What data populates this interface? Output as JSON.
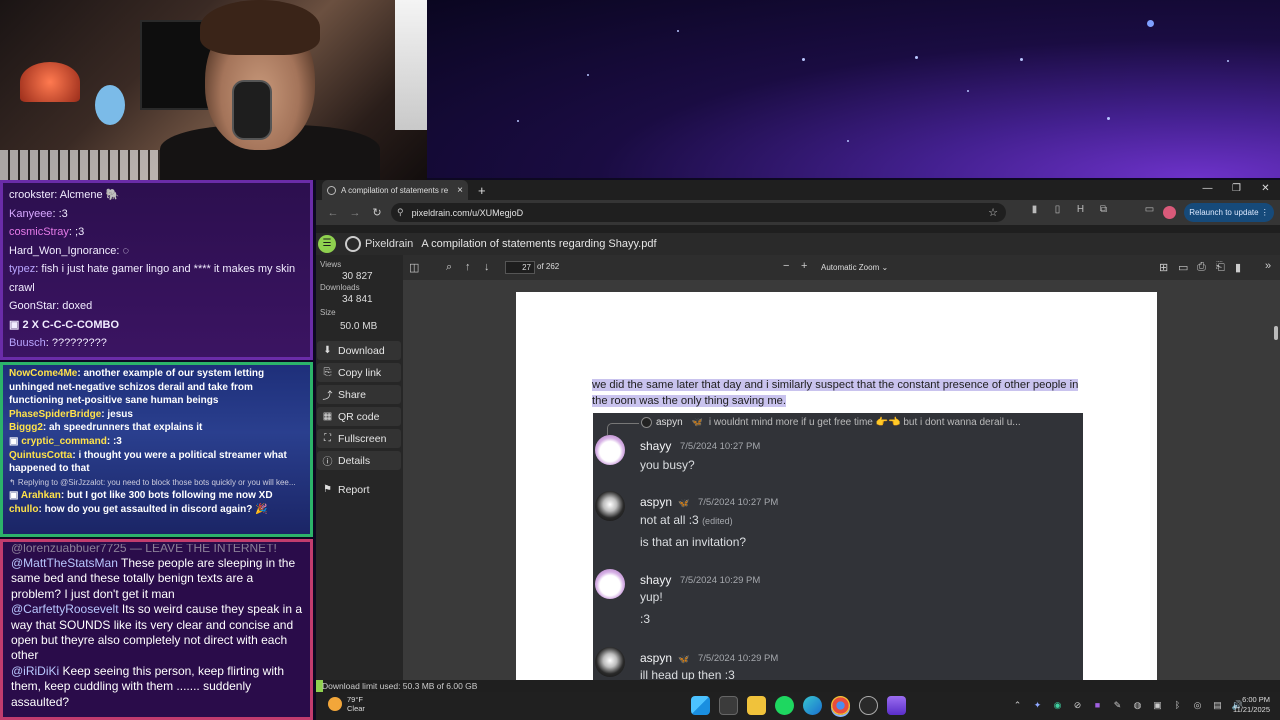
{
  "chat_top": {
    "messages": [
      {
        "user": "crookster",
        "text": "Alcmene",
        "user_color": "#f1ecff",
        "suffix": "🐘"
      },
      {
        "user": "Kanyeee",
        "text": ":3",
        "user_color": "#d7a8ff",
        "suffix": ""
      },
      {
        "user": "cosmicStray",
        "text": ";3",
        "user_color": "#e57be8",
        "suffix": ""
      },
      {
        "user": "Hard_Won_Ignorance",
        "text": "",
        "user_color": "#f1ecff",
        "suffix": "◌"
      },
      {
        "user": "typez",
        "text": "fish i just hate gamer lingo and **** it makes my skin crawl",
        "user_color": "#b9a6ff",
        "suffix": ""
      },
      {
        "user": "GoonStar",
        "text": "doxed",
        "user_color": "#f1ecff",
        "suffix": ""
      }
    ],
    "combo": "2 X  C-C-C-COMBO",
    "last_user": "Buusch",
    "last_text": "?????????"
  },
  "chat_mid": {
    "messages": [
      {
        "user": "NowCome4Me",
        "text": "another example of our system letting unhinged net-negative schizos derail and take from functioning net-positive sane human beings"
      },
      {
        "user": "PhaseSpiderBridge",
        "text": "jesus"
      },
      {
        "user": "Biggg2",
        "text": "ah speedrunners that explains it"
      },
      {
        "user": "cryptic_command",
        "text": ":3"
      },
      {
        "user": "QuintusCotta",
        "text": "i thought you were a political streamer what happened to that"
      }
    ],
    "reply_note": "↰ Replying to @SirJzzalot: you need to block those bots quickly or you will kee...",
    "messages2": [
      {
        "user": "Arahkan",
        "text": "but I got like 300 bots following me now XD"
      },
      {
        "user": "chullo",
        "text": "how do you get assaulted in discord again? 🎉"
      }
    ]
  },
  "chat_bottom": {
    "cut_line": "@lorenzuabbuer7725 — LEAVE THE INTERNET!",
    "messages": [
      {
        "user": "@MattTheStatsMan",
        "text": "These people are sleeping in the same bed and these totally benign texts are a problem? I just don't get it man"
      },
      {
        "user": "@CarfettyRoosevelt",
        "text": "Its so weird cause they speak in a way that SOUNDS like its very clear and concise and open but theyre also completely not direct with each other"
      },
      {
        "user": "@iRiDiKi",
        "text": "Keep seeing this person, keep flirting with them, keep cuddling with them ....... suddenly assaulted?"
      }
    ]
  },
  "browser": {
    "tab_title": "A compilation of statements re",
    "tab_close": "×",
    "new_tab": "+",
    "win_min": "—",
    "win_max": "❐",
    "win_close": "✕",
    "back": "←",
    "forward": "→",
    "reload": "↻",
    "url": "pixeldrain.com/u/XUMegjoD",
    "relaunch_label": "Relaunch to update ⋮"
  },
  "pixeldrain": {
    "brand": "Pixeldrain",
    "file_name": "A compilation of statements regarding Shayy.pdf",
    "views_label": "Views",
    "views_value": "30 827",
    "downloads_label": "Downloads",
    "downloads_value": "34 841",
    "size_label": "Size",
    "size_value": "50.0 MB",
    "buttons": {
      "download": "Download",
      "copy_link": "Copy link",
      "share": "Share",
      "qr_code": "QR code",
      "fullscreen": "Fullscreen",
      "details": "Details",
      "report": "Report"
    },
    "download_limit": "Download limit used: 50.3 MB of 6.00 GB"
  },
  "pdf": {
    "page_number": "27",
    "page_count": "of 262",
    "zoom": "Automatic Zoom  ⌄",
    "selected_text": "we did the same later that day and i similarly suspect that the constant presence of other people in the room was the only thing saving me.",
    "reply": {
      "user": "aspyn",
      "text": "i wouldnt mind more if u get free time 👉👈 but i dont wanna derail u..."
    },
    "messages": [
      {
        "user": "shayy",
        "time": "7/5/2024 10:27 PM",
        "lines": [
          "you busy?"
        ],
        "badge": "",
        "edited": ""
      },
      {
        "user": "aspyn",
        "time": "7/5/2024 10:27 PM",
        "lines": [
          "not at all :3",
          "is that an invitation?"
        ],
        "badge": "🦋",
        "edited": "(edited)"
      },
      {
        "user": "shayy",
        "time": "7/5/2024 10:29 PM",
        "lines": [
          "yup!",
          ":3"
        ],
        "badge": "",
        "edited": ""
      },
      {
        "user": "aspyn",
        "time": "7/5/2024 10:29 PM",
        "lines": [
          "ill head up then :3"
        ],
        "badge": "🦋",
        "edited": ""
      }
    ]
  },
  "taskbar": {
    "temp": "79°F",
    "condition": "Clear",
    "time": "6:00 PM",
    "date": "11/21/2025"
  }
}
